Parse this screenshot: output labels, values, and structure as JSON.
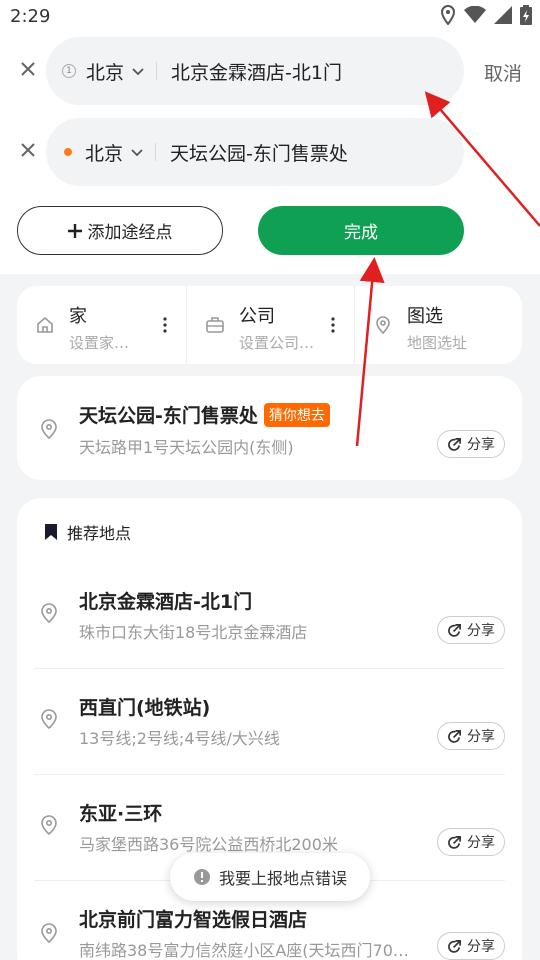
{
  "status_bar": {
    "time": "2:29",
    "icons": [
      "location-icon",
      "wifi-icon",
      "signal-icon",
      "battery-icon"
    ]
  },
  "route": {
    "start": {
      "index": "1",
      "city": "北京",
      "place": "北京金霖酒店-北1门"
    },
    "end": {
      "city": "北京",
      "place": "天坛公园-东门售票处"
    },
    "cancel_label": "取消",
    "add_waypoint_label": "添加途经点",
    "done_label": "完成"
  },
  "quick_access": [
    {
      "title": "家",
      "subtitle": "设置家…",
      "icon": "home-icon"
    },
    {
      "title": "公司",
      "subtitle": "设置公司…",
      "icon": "briefcase-icon"
    },
    {
      "title": "图选",
      "subtitle": "地图选址",
      "icon": "map-pin-icon"
    }
  ],
  "guess": {
    "title": "天坛公园-东门售票处",
    "tag": "猜你想去",
    "address": "天坛路甲1号天坛公园内(东侧)",
    "share_label": "分享"
  },
  "recommended": {
    "header": "推荐地点",
    "items": [
      {
        "title": "北京金霖酒店-北1门",
        "address": "珠市口东大街18号北京金霖酒店",
        "share_label": "分享"
      },
      {
        "title": "西直门(地铁站)",
        "address": "13号线;2号线;4号线/大兴线",
        "share_label": "分享"
      },
      {
        "title": "东亚·三环",
        "address": "马家堡西路36号院公益西桥北200米",
        "share_label": "分享"
      },
      {
        "title": "北京前门富力智选假日酒店",
        "address": "南纬路38号富力信然庭小区A座(天坛西门70…",
        "share_label": "分享"
      }
    ]
  },
  "toast": {
    "label": "我要上报地点错误"
  },
  "colors": {
    "primary": "#10a053",
    "accent_orange": "#ff6a00",
    "annotation_red": "#e02020"
  }
}
